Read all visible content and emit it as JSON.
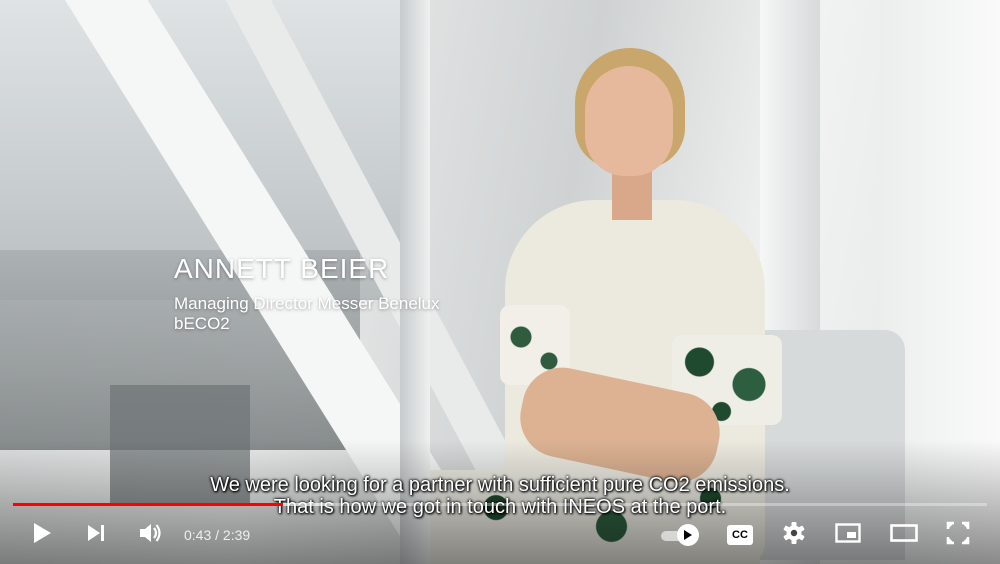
{
  "video": {
    "lower_third": {
      "name": "ANNETT BEIER",
      "role": "Managing Director Messer Benelux",
      "company": "bECO2"
    },
    "subtitles": [
      "We were looking for a partner with sufficient pure CO2 emissions.",
      "That is how we got in touch with INEOS at the port."
    ]
  },
  "player": {
    "accent_color": "#ff0000",
    "progress_fraction": 0.277,
    "buffered_fraction": 0.33,
    "time_current": "0:43",
    "time_separator": " / ",
    "time_total": "2:39",
    "cc_label": "CC",
    "autoplay_on": true,
    "icons": {
      "play": "play-icon",
      "next": "next-icon",
      "volume": "volume-icon",
      "autoplay": "autoplay-toggle-icon",
      "captions": "captions-icon",
      "settings": "gear-icon",
      "miniplayer": "miniplayer-icon",
      "theater": "theater-mode-icon",
      "fullscreen": "fullscreen-icon"
    }
  }
}
